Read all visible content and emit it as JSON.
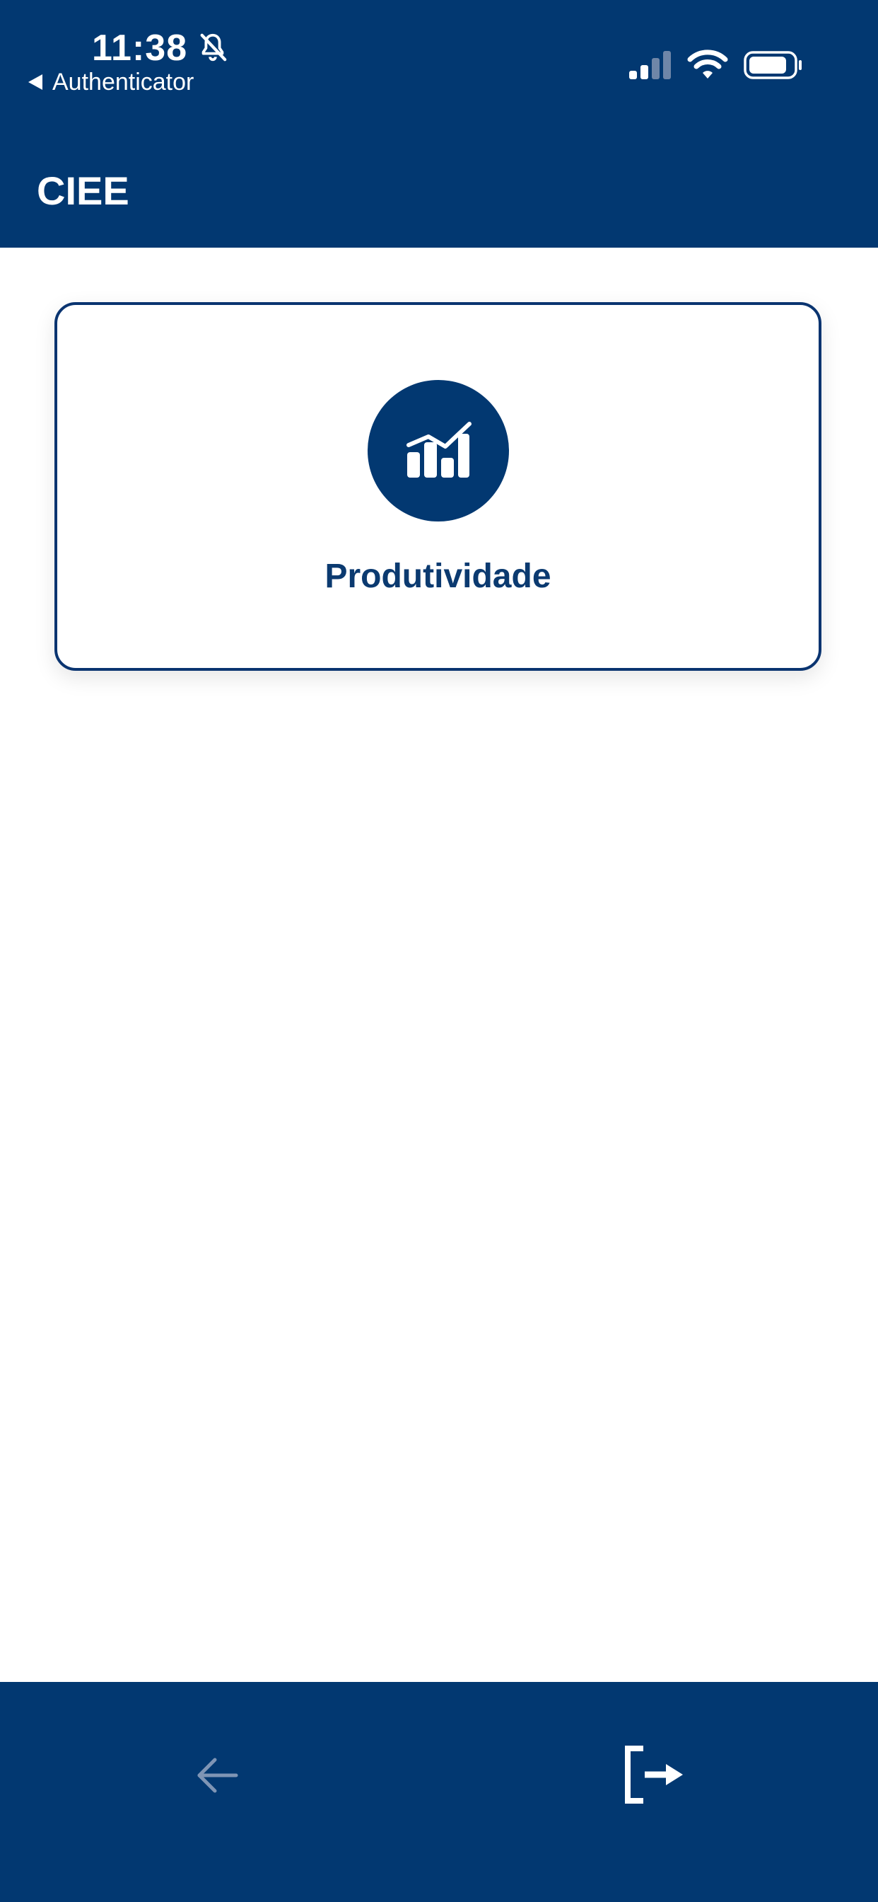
{
  "status_bar": {
    "time": "11:38",
    "back_app_label": "Authenticator",
    "icons": [
      "bell-slash-icon",
      "cellular-signal-icon",
      "wifi-icon",
      "battery-icon"
    ]
  },
  "app_bar": {
    "title": "CIEE"
  },
  "cards": [
    {
      "label": "Produtividade",
      "icon": "bar-chart-icon"
    }
  ],
  "bottom_nav": {
    "back_icon": "arrow-left-icon",
    "logout_icon": "logout-icon"
  },
  "colors": {
    "primary": "#023871",
    "card_border": "#0a3470",
    "label": "#0b3a70",
    "background": "#ffffff",
    "disabled_icon": "#7f95b5"
  }
}
